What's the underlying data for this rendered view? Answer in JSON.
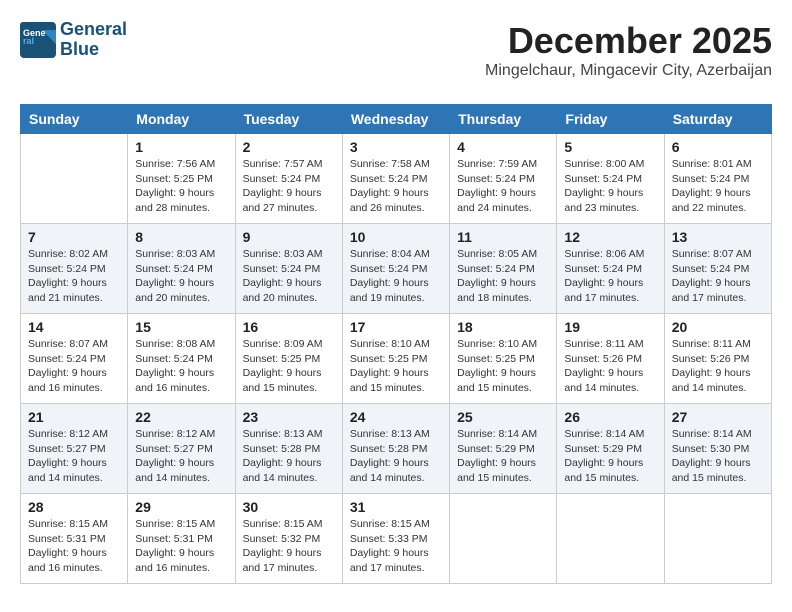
{
  "logo": {
    "line1": "General",
    "line2": "Blue"
  },
  "title": "December 2025",
  "location": "Mingelchaur, Mingacevir City, Azerbaijan",
  "days_of_week": [
    "Sunday",
    "Monday",
    "Tuesday",
    "Wednesday",
    "Thursday",
    "Friday",
    "Saturday"
  ],
  "weeks": [
    [
      {
        "day": "",
        "sunrise": "",
        "sunset": "",
        "daylight": ""
      },
      {
        "day": "1",
        "sunrise": "Sunrise: 7:56 AM",
        "sunset": "Sunset: 5:25 PM",
        "daylight": "Daylight: 9 hours and 28 minutes."
      },
      {
        "day": "2",
        "sunrise": "Sunrise: 7:57 AM",
        "sunset": "Sunset: 5:24 PM",
        "daylight": "Daylight: 9 hours and 27 minutes."
      },
      {
        "day": "3",
        "sunrise": "Sunrise: 7:58 AM",
        "sunset": "Sunset: 5:24 PM",
        "daylight": "Daylight: 9 hours and 26 minutes."
      },
      {
        "day": "4",
        "sunrise": "Sunrise: 7:59 AM",
        "sunset": "Sunset: 5:24 PM",
        "daylight": "Daylight: 9 hours and 24 minutes."
      },
      {
        "day": "5",
        "sunrise": "Sunrise: 8:00 AM",
        "sunset": "Sunset: 5:24 PM",
        "daylight": "Daylight: 9 hours and 23 minutes."
      },
      {
        "day": "6",
        "sunrise": "Sunrise: 8:01 AM",
        "sunset": "Sunset: 5:24 PM",
        "daylight": "Daylight: 9 hours and 22 minutes."
      }
    ],
    [
      {
        "day": "7",
        "sunrise": "Sunrise: 8:02 AM",
        "sunset": "Sunset: 5:24 PM",
        "daylight": "Daylight: 9 hours and 21 minutes."
      },
      {
        "day": "8",
        "sunrise": "Sunrise: 8:03 AM",
        "sunset": "Sunset: 5:24 PM",
        "daylight": "Daylight: 9 hours and 20 minutes."
      },
      {
        "day": "9",
        "sunrise": "Sunrise: 8:03 AM",
        "sunset": "Sunset: 5:24 PM",
        "daylight": "Daylight: 9 hours and 20 minutes."
      },
      {
        "day": "10",
        "sunrise": "Sunrise: 8:04 AM",
        "sunset": "Sunset: 5:24 PM",
        "daylight": "Daylight: 9 hours and 19 minutes."
      },
      {
        "day": "11",
        "sunrise": "Sunrise: 8:05 AM",
        "sunset": "Sunset: 5:24 PM",
        "daylight": "Daylight: 9 hours and 18 minutes."
      },
      {
        "day": "12",
        "sunrise": "Sunrise: 8:06 AM",
        "sunset": "Sunset: 5:24 PM",
        "daylight": "Daylight: 9 hours and 17 minutes."
      },
      {
        "day": "13",
        "sunrise": "Sunrise: 8:07 AM",
        "sunset": "Sunset: 5:24 PM",
        "daylight": "Daylight: 9 hours and 17 minutes."
      }
    ],
    [
      {
        "day": "14",
        "sunrise": "Sunrise: 8:07 AM",
        "sunset": "Sunset: 5:24 PM",
        "daylight": "Daylight: 9 hours and 16 minutes."
      },
      {
        "day": "15",
        "sunrise": "Sunrise: 8:08 AM",
        "sunset": "Sunset: 5:24 PM",
        "daylight": "Daylight: 9 hours and 16 minutes."
      },
      {
        "day": "16",
        "sunrise": "Sunrise: 8:09 AM",
        "sunset": "Sunset: 5:25 PM",
        "daylight": "Daylight: 9 hours and 15 minutes."
      },
      {
        "day": "17",
        "sunrise": "Sunrise: 8:10 AM",
        "sunset": "Sunset: 5:25 PM",
        "daylight": "Daylight: 9 hours and 15 minutes."
      },
      {
        "day": "18",
        "sunrise": "Sunrise: 8:10 AM",
        "sunset": "Sunset: 5:25 PM",
        "daylight": "Daylight: 9 hours and 15 minutes."
      },
      {
        "day": "19",
        "sunrise": "Sunrise: 8:11 AM",
        "sunset": "Sunset: 5:26 PM",
        "daylight": "Daylight: 9 hours and 14 minutes."
      },
      {
        "day": "20",
        "sunrise": "Sunrise: 8:11 AM",
        "sunset": "Sunset: 5:26 PM",
        "daylight": "Daylight: 9 hours and 14 minutes."
      }
    ],
    [
      {
        "day": "21",
        "sunrise": "Sunrise: 8:12 AM",
        "sunset": "Sunset: 5:27 PM",
        "daylight": "Daylight: 9 hours and 14 minutes."
      },
      {
        "day": "22",
        "sunrise": "Sunrise: 8:12 AM",
        "sunset": "Sunset: 5:27 PM",
        "daylight": "Daylight: 9 hours and 14 minutes."
      },
      {
        "day": "23",
        "sunrise": "Sunrise: 8:13 AM",
        "sunset": "Sunset: 5:28 PM",
        "daylight": "Daylight: 9 hours and 14 minutes."
      },
      {
        "day": "24",
        "sunrise": "Sunrise: 8:13 AM",
        "sunset": "Sunset: 5:28 PM",
        "daylight": "Daylight: 9 hours and 14 minutes."
      },
      {
        "day": "25",
        "sunrise": "Sunrise: 8:14 AM",
        "sunset": "Sunset: 5:29 PM",
        "daylight": "Daylight: 9 hours and 15 minutes."
      },
      {
        "day": "26",
        "sunrise": "Sunrise: 8:14 AM",
        "sunset": "Sunset: 5:29 PM",
        "daylight": "Daylight: 9 hours and 15 minutes."
      },
      {
        "day": "27",
        "sunrise": "Sunrise: 8:14 AM",
        "sunset": "Sunset: 5:30 PM",
        "daylight": "Daylight: 9 hours and 15 minutes."
      }
    ],
    [
      {
        "day": "28",
        "sunrise": "Sunrise: 8:15 AM",
        "sunset": "Sunset: 5:31 PM",
        "daylight": "Daylight: 9 hours and 16 minutes."
      },
      {
        "day": "29",
        "sunrise": "Sunrise: 8:15 AM",
        "sunset": "Sunset: 5:31 PM",
        "daylight": "Daylight: 9 hours and 16 minutes."
      },
      {
        "day": "30",
        "sunrise": "Sunrise: 8:15 AM",
        "sunset": "Sunset: 5:32 PM",
        "daylight": "Daylight: 9 hours and 17 minutes."
      },
      {
        "day": "31",
        "sunrise": "Sunrise: 8:15 AM",
        "sunset": "Sunset: 5:33 PM",
        "daylight": "Daylight: 9 hours and 17 minutes."
      },
      {
        "day": "",
        "sunrise": "",
        "sunset": "",
        "daylight": ""
      },
      {
        "day": "",
        "sunrise": "",
        "sunset": "",
        "daylight": ""
      },
      {
        "day": "",
        "sunrise": "",
        "sunset": "",
        "daylight": ""
      }
    ]
  ]
}
